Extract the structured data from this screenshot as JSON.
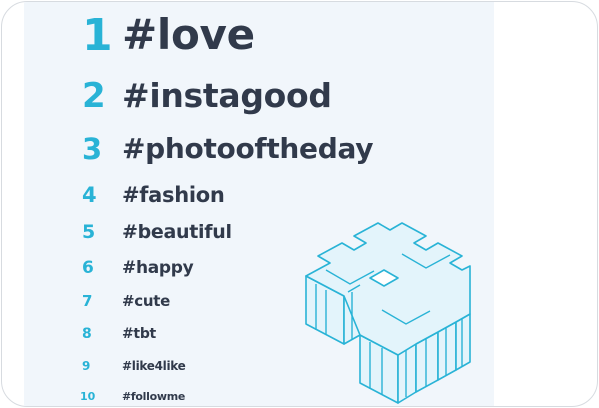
{
  "ranking": [
    {
      "rank": "1",
      "tag": "#love"
    },
    {
      "rank": "2",
      "tag": "#instagood"
    },
    {
      "rank": "3",
      "tag": "#photooftheday"
    },
    {
      "rank": "4",
      "tag": "#fashion"
    },
    {
      "rank": "5",
      "tag": "#beautiful"
    },
    {
      "rank": "6",
      "tag": "#happy"
    },
    {
      "rank": "7",
      "tag": "#cute"
    },
    {
      "rank": "8",
      "tag": "#tbt"
    },
    {
      "rank": "9",
      "tag": "#like4like"
    },
    {
      "rank": "10",
      "tag": "#followme"
    }
  ],
  "colors": {
    "accent": "#29b3d6",
    "text": "#313a4b",
    "panel": "#f1f6fb",
    "illustration_fill": "#e3f4fb"
  },
  "illustration": {
    "icon": "hashtag-3d-icon"
  }
}
